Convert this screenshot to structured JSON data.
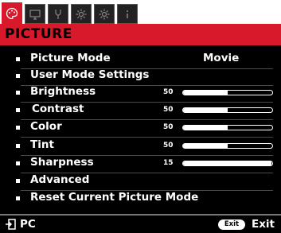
{
  "tabs": [
    {
      "icon": "palette-icon",
      "active": true
    },
    {
      "icon": "screen-icon",
      "active": false
    },
    {
      "icon": "settings-wrench-icon",
      "active": false
    },
    {
      "icon": "gear-icon",
      "active": false
    },
    {
      "icon": "gear-plus-icon",
      "active": false
    },
    {
      "icon": "info-icon",
      "active": false
    }
  ],
  "header": {
    "title": "PICTURE"
  },
  "menu": {
    "picture_mode": {
      "label": "Picture Mode",
      "value": "Movie"
    },
    "user_mode": {
      "label": "User Mode Settings"
    },
    "brightness": {
      "label": "Brightness",
      "value": "50",
      "level": 0.5
    },
    "contrast": {
      "label": "Contrast",
      "value": "50",
      "level": 0.5
    },
    "color": {
      "label": "Color",
      "value": "50",
      "level": 0.5
    },
    "tint": {
      "label": "Tint",
      "value": "50",
      "level": 0.5
    },
    "sharpness": {
      "label": "Sharpness",
      "value": "15",
      "level": 0.99
    },
    "advanced": {
      "label": "Advanced"
    },
    "reset": {
      "label": "Reset Current Picture Mode"
    }
  },
  "footer": {
    "source_label": "PC",
    "exit_button": "Exit",
    "exit_label": "Exit"
  }
}
